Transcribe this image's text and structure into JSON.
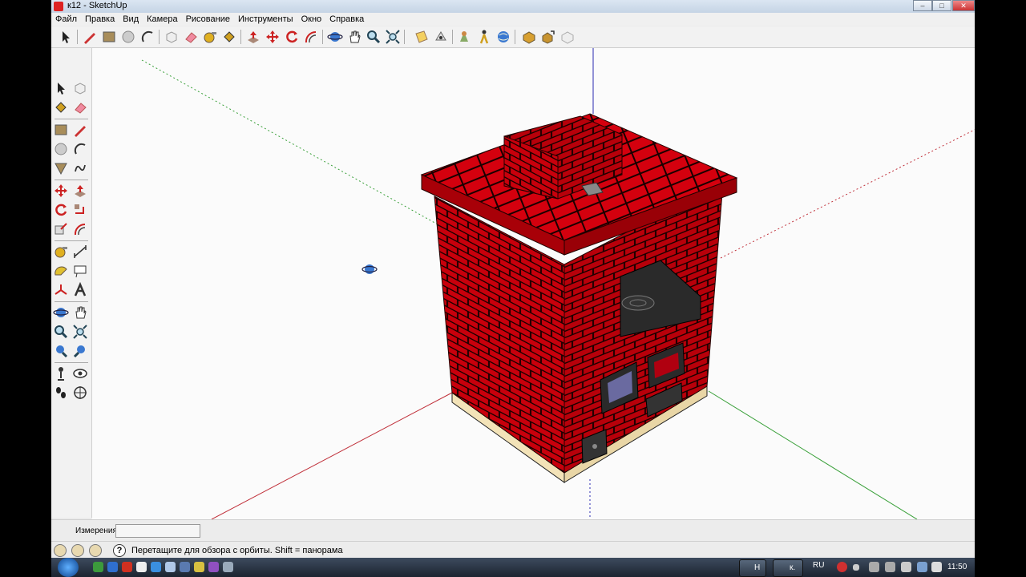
{
  "window": {
    "title": "к12 - SketchUp",
    "controls": [
      "–",
      "□",
      "✕"
    ]
  },
  "menu": [
    "Файл",
    "Правка",
    "Вид",
    "Камера",
    "Рисование",
    "Инструменты",
    "Окно",
    "Справка"
  ],
  "toolbar": {
    "tools": [
      "select-icon",
      "pencil-icon",
      "rectangle-icon",
      "circle-icon",
      "arc-icon",
      "make-component-icon",
      "eraser-icon",
      "tape-measure-icon",
      "paint-bucket-icon",
      "push-pull-icon",
      "move-icon",
      "rotate-icon",
      "offset-icon",
      "orbit-icon",
      "pan-icon",
      "zoom-icon",
      "zoom-extents-icon",
      "section-plane-icon",
      "camera-position-icon",
      "walk-icon",
      "look-around-icon",
      "get-models-icon",
      "share-model-icon",
      "share-component-icon",
      "component-icon"
    ]
  },
  "left_toolbar": {
    "tools": [
      "select-icon",
      "make-component-icon",
      "paint-bucket-icon",
      "eraser-icon",
      "rectangle-icon",
      "line-icon",
      "circle-icon",
      "arc-icon",
      "polygon-icon",
      "freehand-icon",
      "move-icon",
      "push-pull-icon",
      "rotate-icon",
      "follow-me-icon",
      "scale-icon",
      "offset-icon",
      "tape-measure-icon",
      "dimension-icon",
      "protractor-icon",
      "text-icon",
      "axes-icon",
      "3d-text-icon",
      "orbit-icon",
      "pan-icon",
      "zoom-icon",
      "zoom-window-icon",
      "previous-view-icon",
      "zoom-extents-icon",
      "position-camera-icon",
      "look-around-icon",
      "walk-icon",
      "section-plane-icon"
    ]
  },
  "vcb": {
    "label": "Измерения",
    "value": ""
  },
  "status": {
    "message": "Перетащите для обзора с орбиты.  Shift = панорама"
  },
  "taskbar": {
    "items": [
      "Н",
      "к."
    ],
    "lang": "RU",
    "time": "11:50"
  },
  "colors": {
    "brick": "#c8000c",
    "mortar": "#1a0000",
    "base": "#f3e3b8",
    "axis_red": "#c0303a",
    "axis_green": "#3aa03a",
    "axis_blue": "#2a2ab0"
  }
}
